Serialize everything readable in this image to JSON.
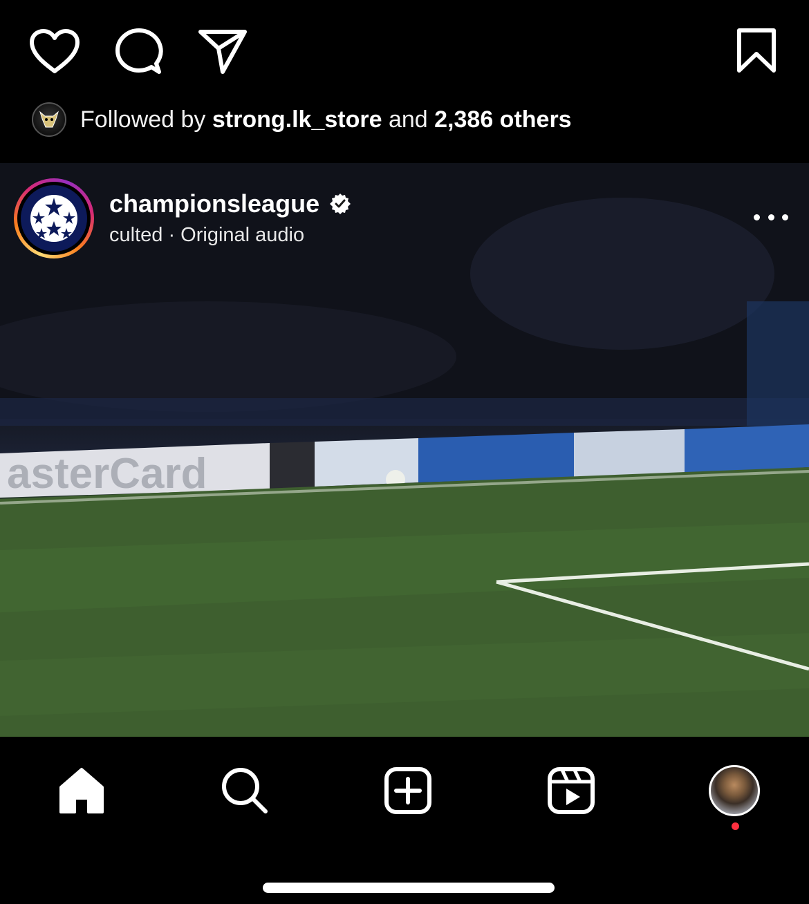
{
  "action_bar": {
    "icons": [
      "heart-icon",
      "comment-icon",
      "share-icon",
      "bookmark-icon"
    ]
  },
  "followed": {
    "prefix": "Followed by",
    "follower": "strong.lk_store",
    "conjunction": "and",
    "count": "2,386 others"
  },
  "post": {
    "username": "championsleague",
    "verified": true,
    "meta": "culted · Original audio",
    "more_icon": "more-horizontal-icon"
  },
  "bottom_nav": {
    "items": [
      "home-icon",
      "search-icon",
      "create-icon",
      "reels-icon",
      "profile-avatar"
    ],
    "notification_color": "#ff3040"
  },
  "colors": {
    "background": "#000000",
    "text": "#ffffff",
    "story_ring": [
      "#feda75",
      "#fa7e1e",
      "#d62976",
      "#962fbf"
    ]
  }
}
